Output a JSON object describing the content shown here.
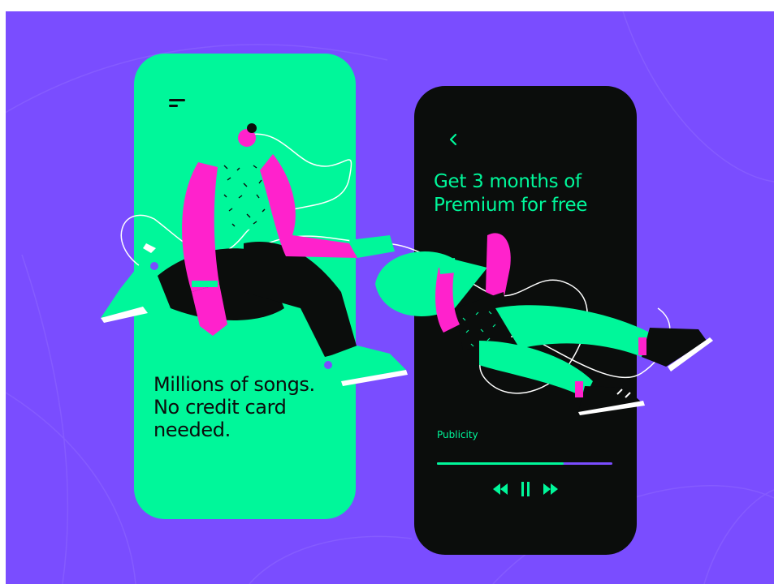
{
  "colors": {
    "background": "#7a4dff",
    "green": "#00f79a",
    "dark": "#0b0d0c",
    "magenta": "#ff22cc",
    "white": "#ffffff"
  },
  "left_screen": {
    "menu_icon": "menu-icon",
    "tagline_lines": [
      "Millions of songs.",
      "No credit card",
      "needed."
    ]
  },
  "right_screen": {
    "back_icon": "chevron-left-icon",
    "title_lines": [
      "Get 3 months of",
      "Premium for free"
    ],
    "track_name": "Publicity",
    "progress": 0.72,
    "controls": {
      "rewind_icon": "rewind-icon",
      "pause_icon": "pause-icon",
      "forward_icon": "fast-forward-icon"
    }
  }
}
